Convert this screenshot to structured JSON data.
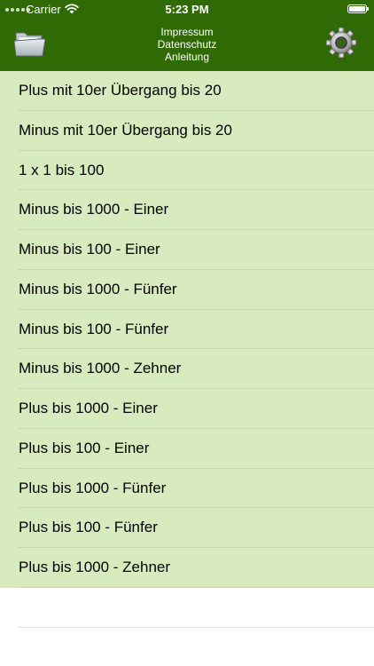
{
  "status_bar": {
    "carrier": "Carrier",
    "time": "5:23 PM"
  },
  "header": {
    "links": [
      "Impressum",
      "Datenschutz",
      "Anleitung"
    ],
    "left_icon": "folder-icon",
    "right_icon": "gear-icon"
  },
  "colors": {
    "header_bg": "#2f6a04",
    "list_bg": "#d7ebbf",
    "separator": "#c3d9ab"
  },
  "list": {
    "items": [
      "Plus mit 10er Übergang bis 20",
      "Minus mit 10er Übergang bis 20",
      "1 x 1 bis 100",
      "Minus bis 1000 - Einer",
      "Minus bis 100 - Einer",
      "Minus bis 1000 - Fünfer",
      "Minus bis 100 - Fünfer",
      "Minus bis 1000 - Zehner",
      "Plus bis 1000 - Einer",
      "Plus bis 100 - Einer",
      "Plus bis 1000 - Fünfer",
      "Plus bis 100 - Fünfer",
      "Plus bis 1000 - Zehner"
    ]
  }
}
